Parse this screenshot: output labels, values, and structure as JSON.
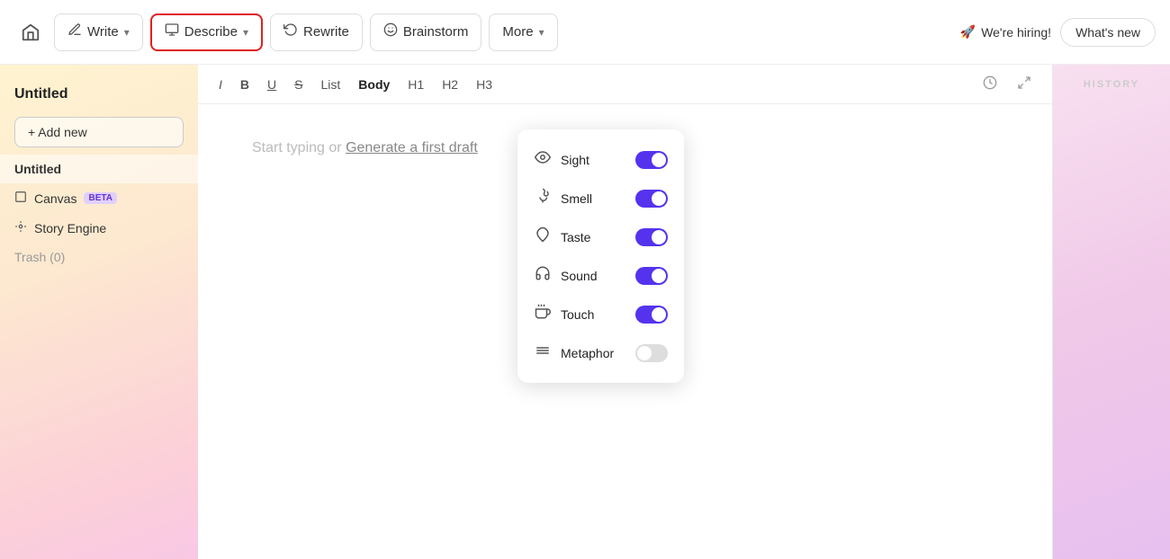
{
  "topbar": {
    "home_icon": "🏠",
    "write_label": "Write",
    "describe_label": "Describe",
    "rewrite_label": "Rewrite",
    "brainstorm_label": "Brainstorm",
    "more_label": "More",
    "hiring_label": "We're hiring!",
    "whats_new_label": "What's new"
  },
  "sidebar": {
    "doc_title": "Untitled",
    "add_new_label": "+ Add new",
    "items": [
      {
        "label": "Untitled",
        "active": true,
        "icon": "",
        "badge": null
      },
      {
        "label": "Canvas",
        "active": false,
        "icon": "▭",
        "badge": "BETA"
      },
      {
        "label": "Story Engine",
        "active": false,
        "icon": "⚙",
        "badge": null
      },
      {
        "label": "Trash (0)",
        "active": false,
        "icon": "",
        "badge": null,
        "muted": true
      }
    ]
  },
  "toolbar": {
    "buttons": [
      "I",
      "B",
      "U",
      "S",
      "List",
      "Body",
      "H1",
      "H2",
      "H3"
    ]
  },
  "editor": {
    "placeholder": "Start typing or",
    "generate_link": "Generate a first draft"
  },
  "dropdown": {
    "items": [
      {
        "label": "Sight",
        "icon": "👁",
        "enabled": true
      },
      {
        "label": "Smell",
        "icon": "👃",
        "enabled": true
      },
      {
        "label": "Taste",
        "icon": "👅",
        "enabled": true
      },
      {
        "label": "Sound",
        "icon": "👂",
        "enabled": true
      },
      {
        "label": "Touch",
        "icon": "🤌",
        "enabled": true
      },
      {
        "label": "Metaphor",
        "icon": "〰",
        "enabled": false
      }
    ]
  },
  "right_panel": {
    "label": "HISTORY"
  }
}
